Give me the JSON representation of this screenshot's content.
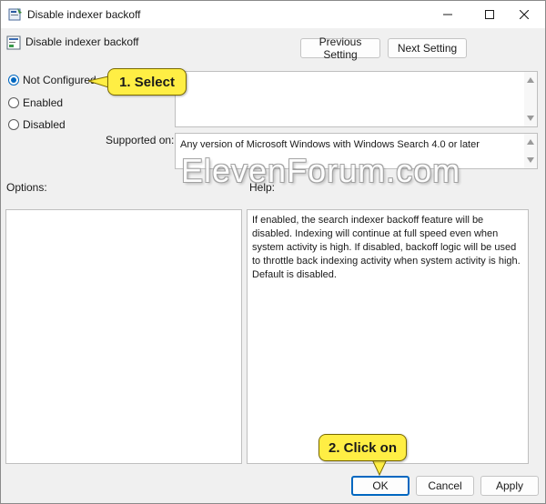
{
  "window": {
    "title": "Disable indexer backoff",
    "controls": {
      "minimize": "minimize-icon",
      "maximize": "maximize-icon",
      "close": "close-icon"
    }
  },
  "header": {
    "title": "Disable indexer backoff",
    "prev_label": "Previous Setting",
    "next_label": "Next Setting"
  },
  "state": {
    "options": [
      "Not Configured",
      "Enabled",
      "Disabled"
    ],
    "selected": "Not Configured"
  },
  "supported": {
    "label": "Supported on:",
    "value": "Any version of Microsoft Windows with Windows Search 4.0 or later"
  },
  "options_label": "Options:",
  "help": {
    "label": "Help:",
    "text": "If enabled, the search indexer backoff feature will be disabled. Indexing will continue at full speed even when system activity is high. If disabled, backoff logic will be used to throttle back indexing activity when system activity is high. Default is disabled."
  },
  "footer": {
    "ok": "OK",
    "cancel": "Cancel",
    "apply": "Apply"
  },
  "annotations": {
    "step1": "1. Select",
    "step2": "2. Click on"
  },
  "watermark": "ElevenForum.com",
  "colors": {
    "accent": "#0067c0",
    "callout": "#ffee44"
  }
}
